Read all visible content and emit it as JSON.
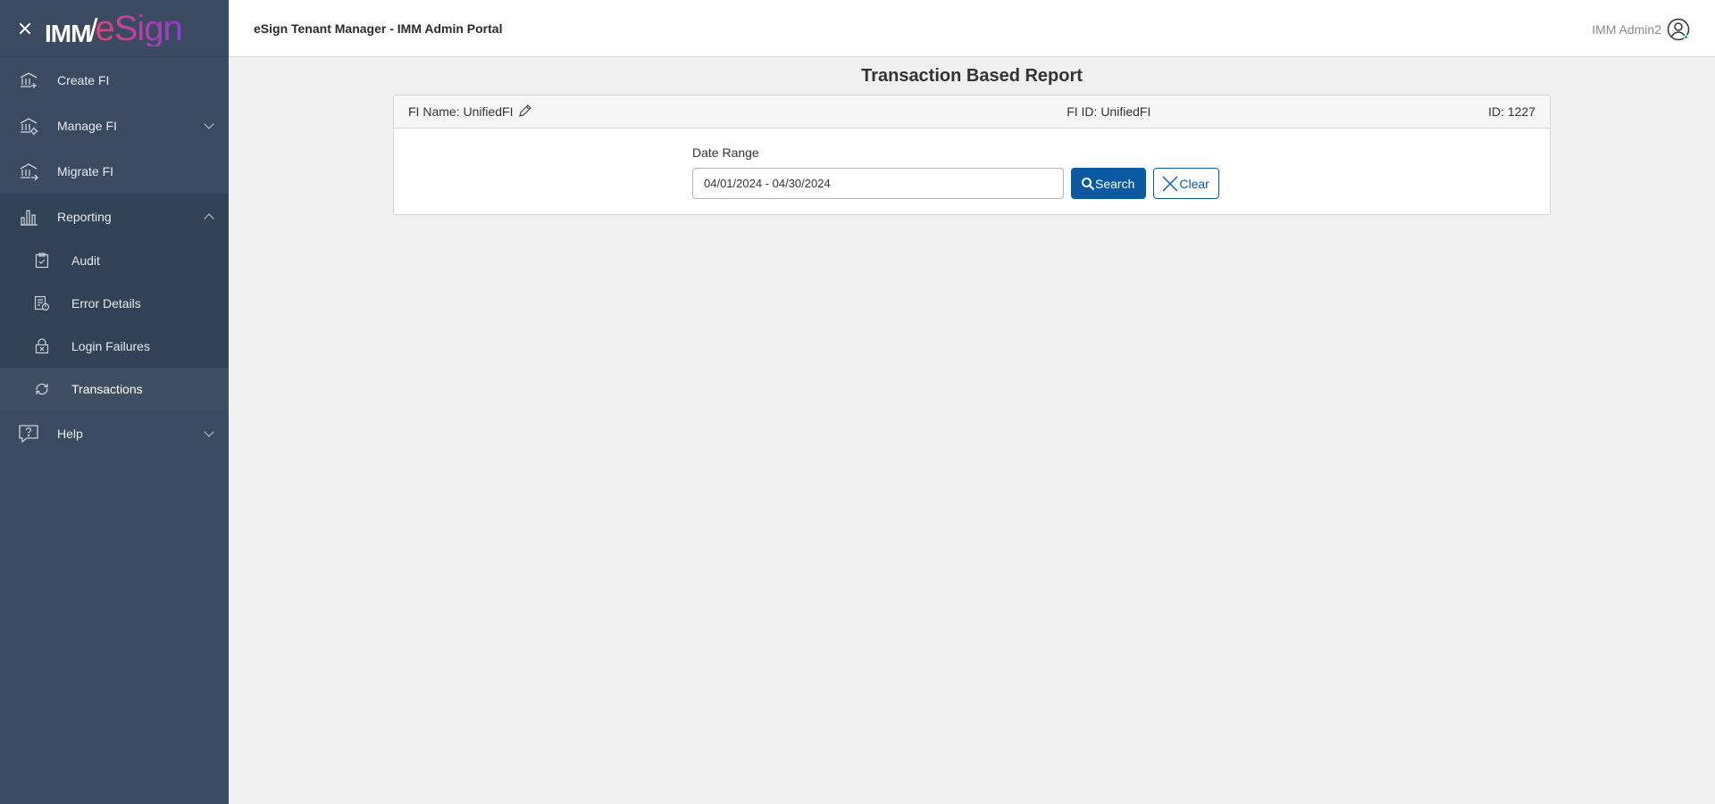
{
  "brand": {
    "logo_left": "IMM",
    "logo_right": "eSign"
  },
  "sidebar": {
    "items": [
      {
        "label": "Create FI",
        "icon": "bank-plus-icon"
      },
      {
        "label": "Manage FI",
        "icon": "bank-gear-icon"
      },
      {
        "label": "Migrate FI",
        "icon": "bank-arrow-icon"
      },
      {
        "label": "Reporting",
        "icon": "bar-chart-icon"
      },
      {
        "label": "Help",
        "icon": "help-icon"
      }
    ],
    "reporting_sub": [
      {
        "label": "Audit",
        "icon": "clipboard-check-icon"
      },
      {
        "label": "Error Details",
        "icon": "error-doc-icon"
      },
      {
        "label": "Login Failures",
        "icon": "lock-x-icon"
      },
      {
        "label": "Transactions",
        "icon": "sync-icon"
      }
    ]
  },
  "header": {
    "title": "eSign Tenant Manager - IMM Admin Portal",
    "user_name": "IMM Admin2"
  },
  "main": {
    "title": "Transaction Based Report",
    "fi_name": "FI Name: UnifiedFI",
    "fi_id": "FI ID: UnifiedFI",
    "id": "ID: 1227",
    "date_range_label": "Date Range",
    "date_range_value": "04/01/2024 - 04/30/2024",
    "search_label": "Search",
    "clear_label": "Clear"
  },
  "colors": {
    "sidebar_bg": "#3b4a60",
    "primary": "#0a5aa3",
    "page_bg": "#f0f0f0"
  }
}
